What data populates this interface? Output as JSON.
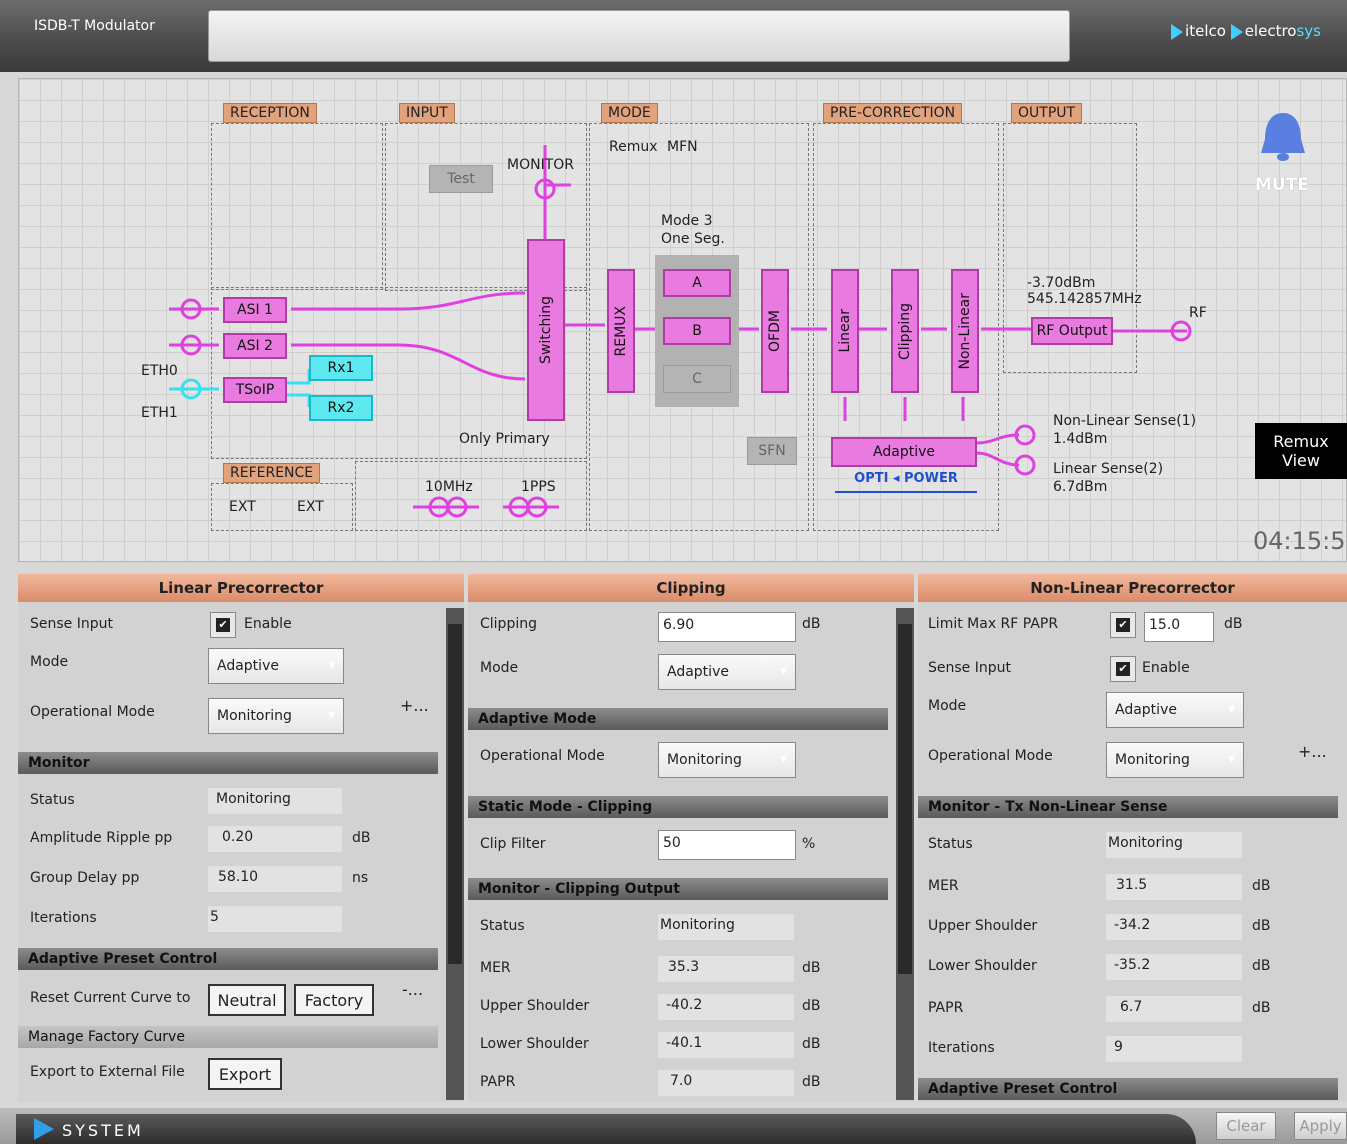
{
  "app": {
    "title": "ISDB-T Modulator",
    "brand_1": "itelco",
    "brand_2a": "electro",
    "brand_2b": "sys"
  },
  "diagram": {
    "sections": {
      "reception": "RECEPTION",
      "input": "INPUT",
      "mode": "MODE",
      "precorrection": "PRE-CORRECTION",
      "output": "OUTPUT",
      "reference": "REFERENCE"
    },
    "test_button": "Test",
    "monitor": "MONITOR",
    "asi1": "ASI 1",
    "asi2": "ASI 2",
    "tsoip": "TSoIP",
    "rx1": "Rx1",
    "rx2": "Rx2",
    "eth0": "ETH0",
    "eth1": "ETH1",
    "switching": "Switching",
    "only_primary": "Only Primary",
    "remux_mode": "Remux",
    "mfn": "MFN",
    "mode3": "Mode 3",
    "one_seg": "One Seg.",
    "remux_block": "REMUX",
    "layer_a": "A",
    "layer_b": "B",
    "layer_c": "C",
    "ofdm": "OFDM",
    "sfn": "SFN",
    "linear": "Linear",
    "clipping": "Clipping",
    "nonlinear": "Non-Linear",
    "adaptive": "Adaptive",
    "optipower": "OPTI",
    "optipower2": "POWER",
    "power_level": "-3.70dBm",
    "frequency": "545.142857MHz",
    "rf_output": "RF Output",
    "rf": "RF",
    "nl_sense": "Non-Linear Sense(1)",
    "nl_sense_val": "1.4dBm",
    "l_sense": "Linear Sense(2)",
    "l_sense_val": "6.7dBm",
    "ref_ext1": "EXT",
    "ref_ext2": "EXT",
    "ref_10mhz": "10MHz",
    "ref_1pps": "1PPS",
    "mute": "MUTE",
    "remux_view": "Remux View",
    "clock": "04:15:5"
  },
  "linear": {
    "title": "Linear Precorrector",
    "sense_input": "Sense Input",
    "enable": "Enable",
    "mode": "Mode",
    "mode_val": "Adaptive",
    "op_mode": "Operational Mode",
    "op_mode_val": "Monitoring",
    "more": "+...",
    "monitor": "Monitor",
    "status": "Status",
    "status_val": "Monitoring",
    "ripple": "Amplitude Ripple pp",
    "ripple_val": "0.20",
    "ripple_unit": "dB",
    "gdelay": "Group Delay pp",
    "gdelay_val": "58.10",
    "gdelay_unit": "ns",
    "iterations": "Iterations",
    "iterations_val": "5",
    "apc": "Adaptive Preset Control",
    "reset": "Reset Current Curve to",
    "neutral": "Neutral",
    "factory": "Factory",
    "more2": "-...",
    "manage": "Manage Factory Curve",
    "export_lbl": "Export to External File",
    "export": "Export"
  },
  "clipping": {
    "title": "Clipping",
    "clipping": "Clipping",
    "clipping_val": "6.90",
    "clipping_unit": "dB",
    "mode": "Mode",
    "mode_val": "Adaptive",
    "adaptive_mode": "Adaptive Mode",
    "op_mode": "Operational Mode",
    "op_mode_val": "Monitoring",
    "static": "Static Mode - Clipping",
    "clip_filter": "Clip Filter",
    "clip_filter_val": "50",
    "clip_filter_unit": "%",
    "monitor": "Monitor - Clipping Output",
    "status": "Status",
    "status_val": "Monitoring",
    "mer": "MER",
    "mer_val": "35.3",
    "mer_unit": "dB",
    "upper": "Upper Shoulder",
    "upper_val": "-40.2",
    "upper_unit": "dB",
    "lower": "Lower Shoulder",
    "lower_val": "-40.1",
    "lower_unit": "dB",
    "papr": "PAPR",
    "papr_val": "7.0",
    "papr_unit": "dB"
  },
  "nonlinear": {
    "title": "Non-Linear Precorrector",
    "limit": "Limit Max RF PAPR",
    "limit_val": "15.0",
    "limit_unit": "dB",
    "sense_input": "Sense Input",
    "enable": "Enable",
    "mode": "Mode",
    "mode_val": "Adaptive",
    "op_mode": "Operational Mode",
    "op_mode_val": "Monitoring",
    "more": "+...",
    "monitor": "Monitor - Tx Non-Linear Sense",
    "status": "Status",
    "status_val": "Monitoring",
    "mer": "MER",
    "mer_val": "31.5",
    "mer_unit": "dB",
    "upper": "Upper Shoulder",
    "upper_val": "-34.2",
    "upper_unit": "dB",
    "lower": "Lower Shoulder",
    "lower_val": "-35.2",
    "lower_unit": "dB",
    "papr": "PAPR",
    "papr_val": "6.7",
    "papr_unit": "dB",
    "iterations": "Iterations",
    "iterations_val": "9",
    "apc": "Adaptive Preset Control"
  },
  "bottom": {
    "system": "SYSTEM",
    "clear": "Clear",
    "apply": "Apply"
  },
  "colors": {
    "accent": "#e87ae0",
    "cyan": "#5ee8f0",
    "header": "#d98c6a"
  }
}
